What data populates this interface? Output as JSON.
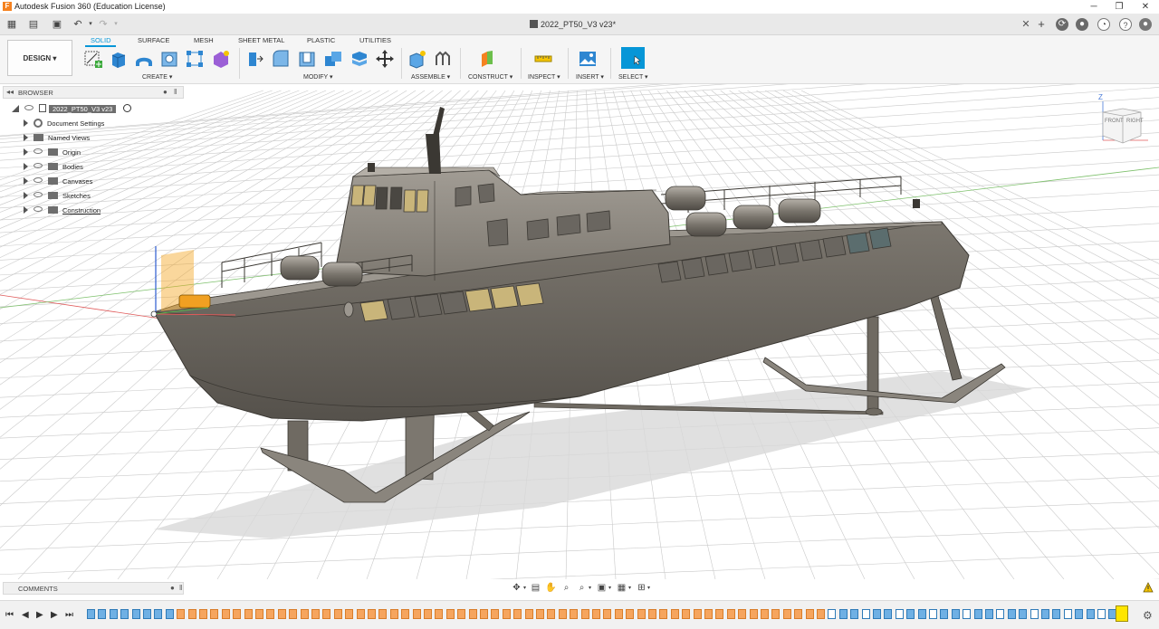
{
  "window": {
    "title": "Autodesk Fusion 360 (Education License)",
    "app_icon_glyph": "F"
  },
  "document": {
    "tab_title": "2022_PT50_V3 v23*"
  },
  "toolbar": {
    "workspace": "DESIGN ▾",
    "tabs": [
      "SOLID",
      "SURFACE",
      "MESH",
      "SHEET METAL",
      "PLASTIC",
      "UTILITIES"
    ],
    "active_tab": "SOLID",
    "groups": [
      "CREATE ▾",
      "MODIFY ▾",
      "ASSEMBLE ▾",
      "CONSTRUCT ▾",
      "INSPECT ▾",
      "INSERT ▾",
      "SELECT ▾"
    ]
  },
  "browser": {
    "header": "BROWSER",
    "root": "2022_PT50_V3 v23",
    "items": [
      "Document Settings",
      "Named Views",
      "Origin",
      "Bodies",
      "Canvases",
      "Sketches",
      "Construction"
    ]
  },
  "comments": {
    "header": "COMMENTS"
  },
  "viewcube": {
    "front": "FRONT",
    "right": "RIGHT",
    "axis_z": "Z"
  },
  "colors": {
    "accent": "#0696d7",
    "hull": "#6f6a62",
    "superstructure": "#8c877f",
    "window": "#c9b57a",
    "highlight": "#f5a623"
  },
  "icons": {
    "undo": "undo-icon",
    "redo": "redo-icon",
    "save": "save-icon",
    "grid": "grid-icon"
  }
}
